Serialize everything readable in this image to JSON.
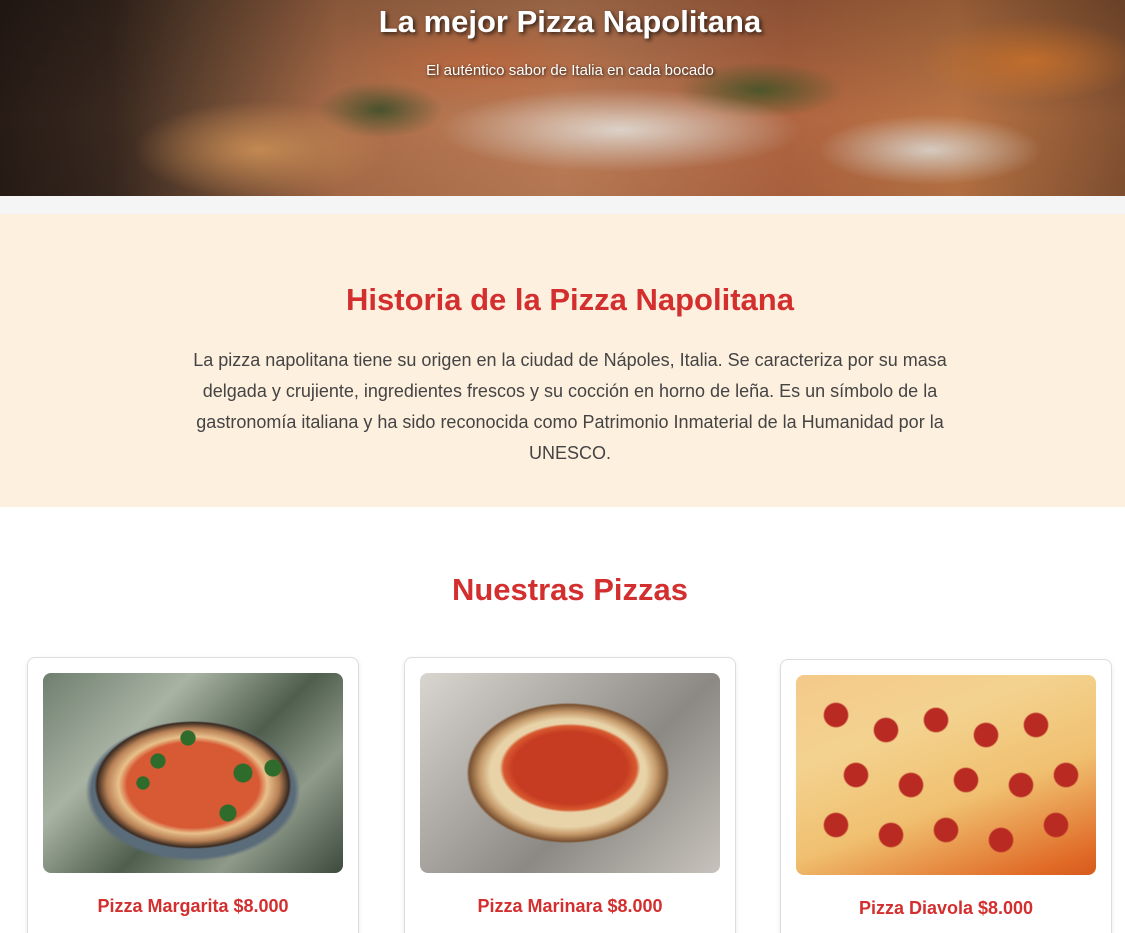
{
  "hero": {
    "title": "La mejor Pizza Napolitana",
    "subtitle": "El auténtico sabor de Italia en cada bocado"
  },
  "history": {
    "title": "Historia de la Pizza Napolitana",
    "text": "La pizza napolitana tiene su origen en la ciudad de Nápoles, Italia. Se caracteriza por su masa delgada y crujiente, ingredientes frescos y su cocción en horno de leña. Es un símbolo de la gastronomía italiana y ha sido reconocida como Patrimonio Inmaterial de la Humanidad por la UNESCO."
  },
  "pizzas": {
    "title": "Nuestras Pizzas",
    "items": [
      {
        "label": "Pizza Margarita $8.000"
      },
      {
        "label": "Pizza Marinara $8.000"
      },
      {
        "label": "Pizza Diavola $8.000"
      }
    ]
  },
  "colors": {
    "accent": "#d32f2f",
    "history_bg": "#fef0df"
  }
}
